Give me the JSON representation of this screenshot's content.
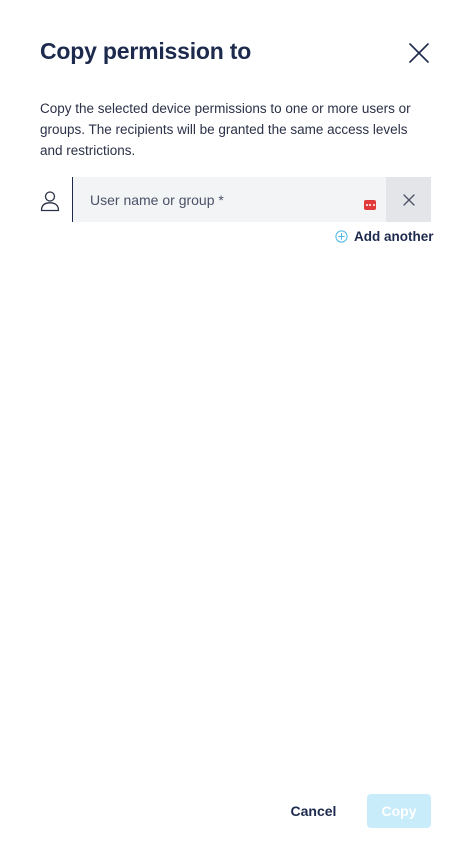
{
  "dialog": {
    "title": "Copy permission to",
    "description": "Copy the selected device permissions to one or more users or groups. The recipients will be granted the same access levels and restrictions.",
    "close_icon": "close-icon"
  },
  "recipient": {
    "icon": "person-icon",
    "value": "",
    "placeholder": "User name or group *",
    "password_manager_icon": "password-manager-icon",
    "remove_icon": "close-icon"
  },
  "add_another": {
    "icon": "plus-circle-icon",
    "label": "Add another"
  },
  "footer": {
    "cancel_label": "Cancel",
    "copy_label": "Copy",
    "copy_disabled": true
  },
  "colors": {
    "primary_text": "#1d2a4d",
    "field_background": "#f3f4f6",
    "remove_background": "#e3e5e9",
    "copy_disabled_background": "#c9ecfb",
    "accent": "#4bb8e8",
    "password_icon": "#e03a3a"
  }
}
